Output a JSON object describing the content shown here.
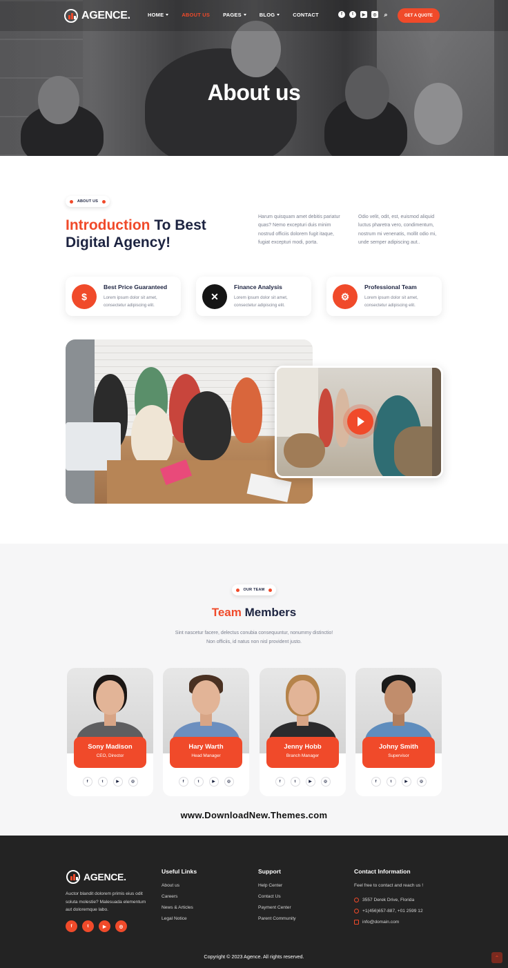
{
  "brand": {
    "name": "AGENCE.",
    "accent": "#f04a2a",
    "dark": "#1c2340"
  },
  "nav": {
    "items": [
      {
        "label": "HOME",
        "dropdown": true,
        "active": false
      },
      {
        "label": "ABOUT US",
        "dropdown": false,
        "active": true
      },
      {
        "label": "PAGES",
        "dropdown": true,
        "active": false
      },
      {
        "label": "BLOG",
        "dropdown": true,
        "active": false
      },
      {
        "label": "CONTACT",
        "dropdown": false,
        "active": false
      }
    ],
    "social_icons": [
      "facebook-icon",
      "twitter-icon",
      "youtube-icon",
      "instagram-icon",
      "search-icon"
    ],
    "quote_button": "GET A QUOTE"
  },
  "hero": {
    "title": "About us"
  },
  "about": {
    "pill": "ABOUT US",
    "title_accent": "Introduction",
    "title_rest": " To Best Digital Agency!",
    "paragraph_1": "Harum quisquam amet debitis pariatur quas? Nemo excepturi duis minim nostrud officiis dolorem fugit itaque, fugiat excepturi modi, porta.",
    "paragraph_2": "Odio velit, odit, est, euismod aliquid luctus pharetra vero, condimentum, nostrum mi venenatis, mollit odio mi, unde semper adipiscing aut..",
    "features": [
      {
        "title": "Best Price Guaranteed",
        "desc": "Lorem ipsum dolor sit amet, consectetur adipiscing elit.",
        "icon": "hand-dollar-icon"
      },
      {
        "title": "Finance Analysis",
        "desc": "Lorem ipsum dolor sit amet, consectetur adipiscing elit.",
        "icon": "tools-icon"
      },
      {
        "title": "Professional Team",
        "desc": "Lorem ipsum dolor sit amet, consectetur adipiscing elit.",
        "icon": "user-gear-icon"
      }
    ]
  },
  "team": {
    "pill": "OUR TEAM",
    "title_accent": "Team",
    "title_rest": " Members",
    "subtitle": "Sint nascetur facere, delectus conubia consequuntur, nonummy distinctio! Non officiis, id natus non nisl provident justo.",
    "members": [
      {
        "name": "Sony Madison",
        "role": "CEO, Director"
      },
      {
        "name": "Hary Warth",
        "role": "Head Manager"
      },
      {
        "name": "Jenny Hobb",
        "role": "Branch Manager"
      },
      {
        "name": "Johny Smith",
        "role": "Supervisor"
      }
    ]
  },
  "watermark": "www.DownloadNew.Themes.com",
  "footer": {
    "about": "Auctor blandit dolorem primis eius odit soluta molestie? Malesuada elementum aut doloremque labo.",
    "useful_title": "Useful Links",
    "useful_links": [
      "About us",
      "Careers",
      "News & Articles",
      "Legal Notice"
    ],
    "support_title": "Support",
    "support_links": [
      "Help Center",
      "Contact Us",
      "Payment Center",
      "Parent Community"
    ],
    "contact_title": "Contact Information",
    "contact_intro": "Feel free to contact and reach us !",
    "address": "3557 Derek Drive, Florida",
    "phone": "+1(456)657-887, +01 2599 12",
    "email": "info@domain.com",
    "copyright": "Copyright © 2023 Agence. All rights reserved."
  }
}
